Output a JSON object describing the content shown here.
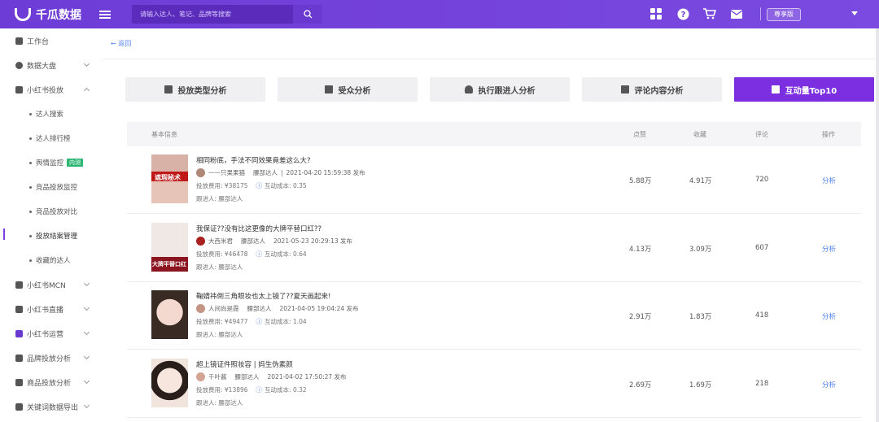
{
  "header": {
    "brand": "千瓜数据",
    "search_placeholder": "请输入达人、笔记、品牌等搜索",
    "tier": "尊享版",
    "icons": [
      "apps-icon",
      "help-icon",
      "cart-icon",
      "mail-icon"
    ]
  },
  "sidebar": {
    "items": [
      {
        "label": "工作台",
        "icon": "grid-icon"
      },
      {
        "label": "数据大盘",
        "icon": "pie-icon"
      },
      {
        "label": "小红书投放",
        "icon": "shield-icon"
      },
      {
        "label": "小红书MCN",
        "icon": "mcn-icon"
      },
      {
        "label": "小红书直播",
        "icon": "live-icon"
      },
      {
        "label": "小红书运营",
        "icon": "store-icon"
      },
      {
        "label": "品牌投放分析",
        "icon": "bar-chart-icon"
      },
      {
        "label": "商品投放分析",
        "icon": "goods-icon"
      },
      {
        "label": "关键词数据导出",
        "icon": "export-icon"
      }
    ],
    "subitems": [
      {
        "label": "达人搜索"
      },
      {
        "label": "达人排行榜"
      },
      {
        "label": "舆情监控",
        "tag": "内测"
      },
      {
        "label": "竞品投放监控"
      },
      {
        "label": "竞品投放对比"
      },
      {
        "label": "投放结案管理"
      },
      {
        "label": "收藏的达人"
      }
    ]
  },
  "main": {
    "back": "← 返回",
    "tabs": [
      {
        "label": "投放类型分析",
        "icon": "folder-icon"
      },
      {
        "label": "受众分析",
        "icon": "document-icon"
      },
      {
        "label": "执行跟进人分析",
        "icon": "person-icon"
      },
      {
        "label": "评论内容分析",
        "icon": "comment-icon"
      },
      {
        "label": "互动量Top10",
        "icon": "chart-icon"
      }
    ],
    "table": {
      "headers": {
        "info": "基本信息",
        "likes": "点赞",
        "collects": "收藏",
        "comments": "评论",
        "action": "操作"
      },
      "rows": [
        {
          "title": "相同粉底，手法不同效果竟差这么大?",
          "author": "一一只果果猫",
          "level": "腰部达人",
          "date": "2021-04-20 15:59:38 发布",
          "cost": "投放费用: ¥38175",
          "rate": "互动成本: 0.35",
          "via": "跟进人: 腰部达人",
          "likes": "5.88万",
          "collects": "4.91万",
          "comments": "720",
          "action": "分析",
          "thumb_text": "遮瑕秘术",
          "thumb_color": "#c01818"
        },
        {
          "title": "我保证??没有比这更像的大牌平替口红??",
          "author": "大西米君",
          "level": "腰部达人",
          "date": "2021-05-23 20:29:13 发布",
          "cost": "投放费用: ¥46478",
          "rate": "互动成本: 0.64",
          "via": "跟进人: 腰部达人",
          "likes": "4.13万",
          "collects": "3.09万",
          "comments": "607",
          "action": "分析",
          "thumb_text": "大牌平替口红",
          "thumb_color": "#8a1520"
        },
        {
          "title": "鞠婧祎倒三角眼妆也太上镜了??夏天画起来!",
          "author": "人间尚是霞",
          "level": "腰部达人",
          "date": "2021-04-05 19:04:24 发布",
          "cost": "投放费用: ¥49477",
          "rate": "互动成本: 1.04",
          "via": "跟进人: 腰部达人",
          "likes": "2.91万",
          "collects": "1.83万",
          "comments": "418",
          "action": "分析",
          "thumb_text": "",
          "thumb_color": "#e8c8c0"
        },
        {
          "title": "超上镜证件照妆容 | 妈生伪素颜",
          "author": "千叶酱",
          "level": "腰部达人",
          "date": "2021-04-02 17:50:27 发布",
          "cost": "投放费用: ¥13896",
          "rate": "互动成本: 0.32",
          "via": "跟进人: 腰部达人",
          "likes": "2.69万",
          "collects": "1.69万",
          "comments": "218",
          "action": "分析",
          "thumb_text": "",
          "thumb_color": "#f1e4dd"
        }
      ]
    }
  },
  "colors": {
    "brand": "#6d3bd6",
    "accent": "#7b2fe0",
    "link": "#4a7cf0",
    "new_tag": "#2bb673"
  }
}
